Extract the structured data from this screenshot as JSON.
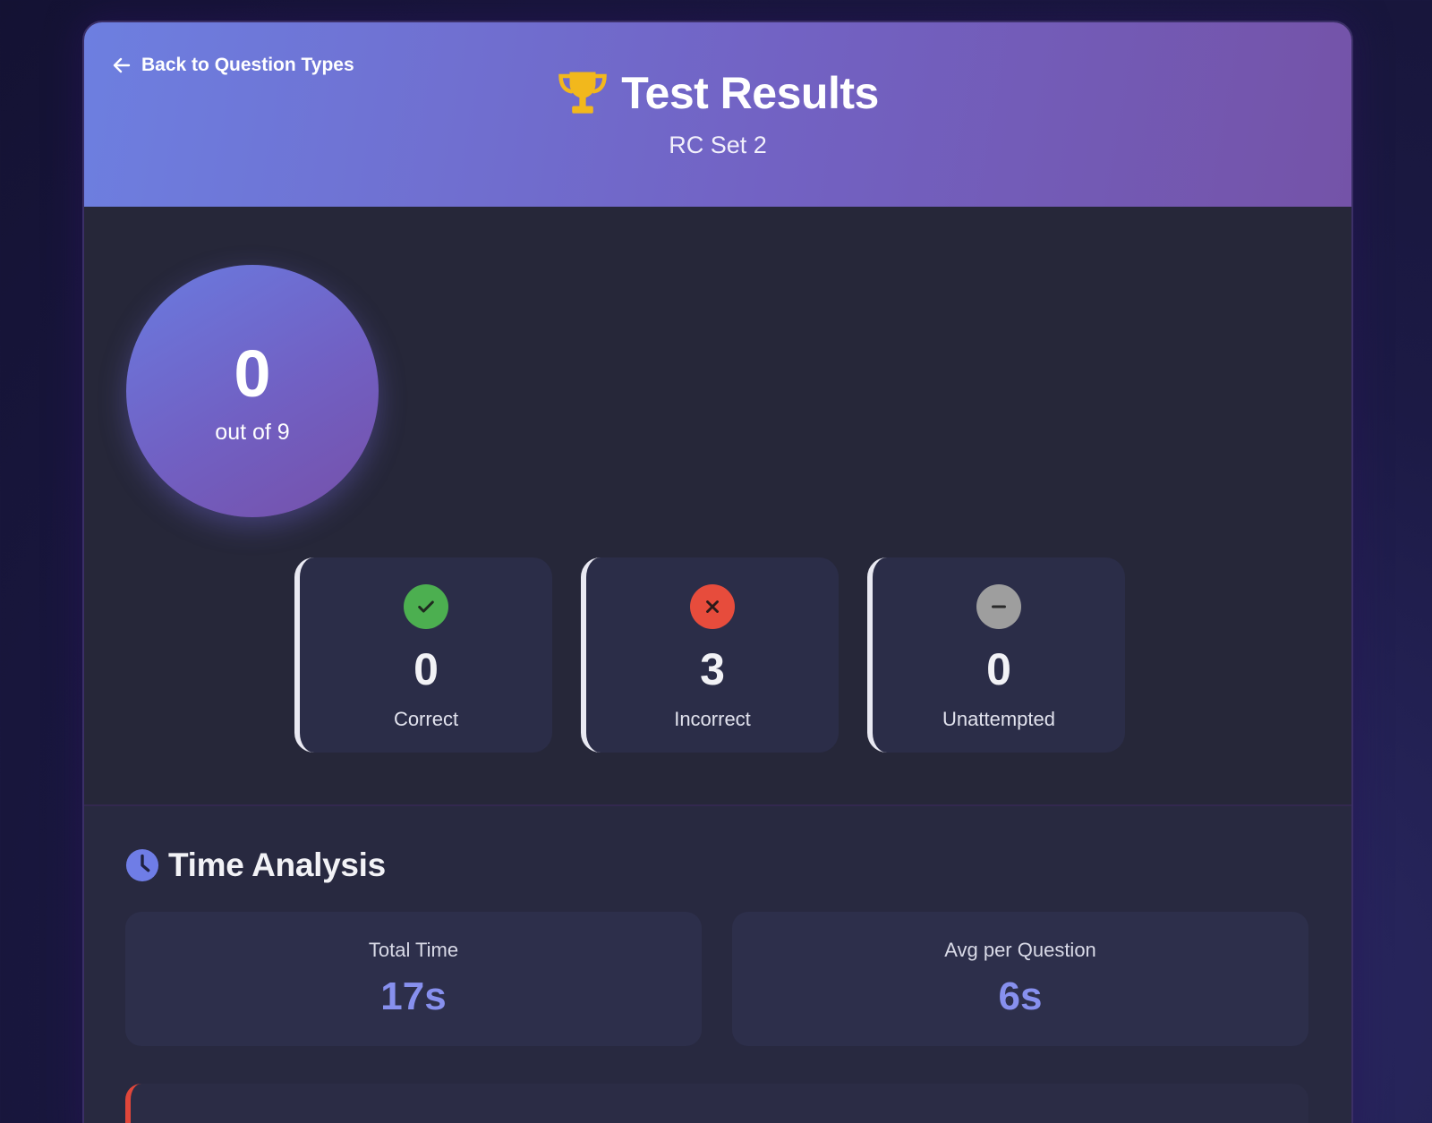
{
  "header": {
    "back_label": "Back to Question Types",
    "title": "Test Results",
    "subtitle": "RC Set 2",
    "icons": {
      "back": "arrow-left-icon",
      "title": "trophy-icon"
    }
  },
  "score": {
    "value": "0",
    "total_label": "out of 9"
  },
  "stats": [
    {
      "value": "0",
      "label": "Correct",
      "icon": "check-circle-icon",
      "color": "#4caf50"
    },
    {
      "value": "3",
      "label": "Incorrect",
      "icon": "x-circle-icon",
      "color": "#e74c3c"
    },
    {
      "value": "0",
      "label": "Unattempted",
      "icon": "minus-circle-icon",
      "color": "#9e9e9e"
    }
  ],
  "time_analysis": {
    "title": "Time Analysis",
    "icon": "clock-icon",
    "total_label": "Total Time",
    "total_value": "17s",
    "avg_label": "Avg per Question",
    "avg_value": "6s"
  },
  "colors": {
    "accent": "#7262c3",
    "value_accent": "#8790ee",
    "trophy": "#f2b81c"
  }
}
